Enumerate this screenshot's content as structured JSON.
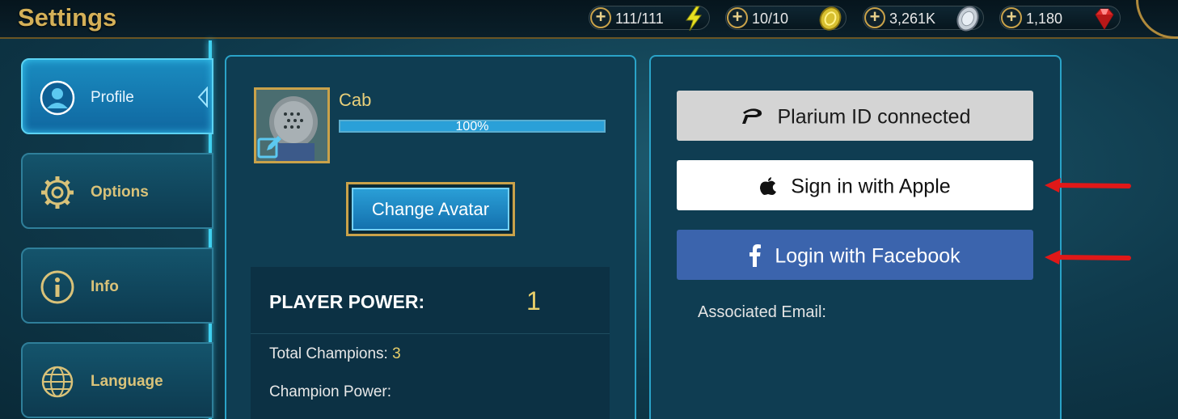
{
  "header": {
    "title": "Settings",
    "resources": [
      {
        "value": "111/111",
        "icon": "energy-bolt-icon"
      },
      {
        "value": "10/10",
        "icon": "gold-key-icon"
      },
      {
        "value": "3,261K",
        "icon": "silver-coin-icon"
      },
      {
        "value": "1,180",
        "icon": "ruby-gem-icon"
      }
    ]
  },
  "sidebar": {
    "items": [
      {
        "label": "Profile",
        "icon": "user-icon",
        "active": true
      },
      {
        "label": "Options",
        "icon": "gear-icon",
        "active": false
      },
      {
        "label": "Info",
        "icon": "info-icon",
        "active": false
      },
      {
        "label": "Language",
        "icon": "globe-icon",
        "active": false
      }
    ]
  },
  "profile": {
    "name": "Cab",
    "progress_text": "100%",
    "progress": 1.0,
    "change_avatar_label": "Change Avatar",
    "power_label": "PLAYER POWER:",
    "power_value": "1",
    "total_champions_label": "Total Champions:",
    "total_champions_value": "3",
    "champion_power_label": "Champion Power:"
  },
  "account": {
    "plarium_label": "Plarium ID connected",
    "apple_label": "Sign in with Apple",
    "facebook_label": "Login with Facebook",
    "email_label": "Associated Email:"
  },
  "colors": {
    "accent_gold": "#d4b058",
    "active_blue": "#1a8cc0",
    "facebook_blue": "#3b64ad",
    "arrow_red": "#e01818"
  }
}
